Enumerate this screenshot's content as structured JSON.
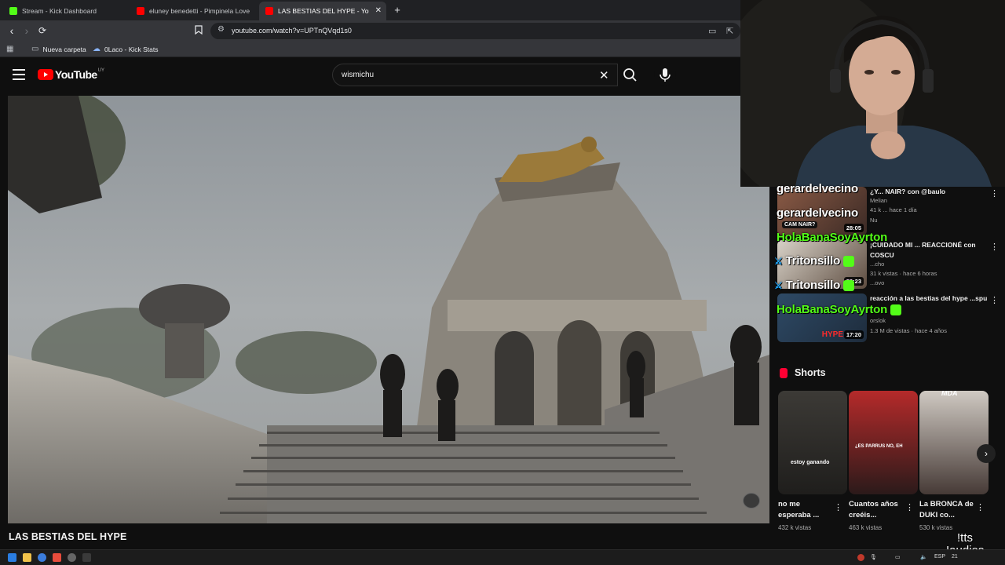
{
  "browser": {
    "tabs": [
      {
        "title": "Stream - Kick Dashboard",
        "favicon": "kick-icon",
        "color": "#53fc18"
      },
      {
        "title": "eluney benedetti - Pimpinela Love (p",
        "favicon": "youtube-icon",
        "color": "#ff0000"
      },
      {
        "title": "LAS BESTIAS DEL HYPE - YouTub",
        "favicon": "youtube-icon",
        "color": "#ff0000"
      }
    ],
    "url": "youtube.com/watch?v=UPTnQVqd1s0",
    "bookmarks": [
      {
        "label": "Nueva carpeta",
        "icon": "folder-icon"
      },
      {
        "label": "0Laco - Kick Stats",
        "icon": "kick-stats-icon"
      }
    ]
  },
  "youtube": {
    "logo_text": "YouTube",
    "country_code": "UY",
    "search_value": "wismichu",
    "video_title": "LAS BESTIAS DEL HYPE"
  },
  "recommendations": [
    {
      "title": "¿Y... NAIR? con @baulo",
      "channel": "Melian",
      "meta": "41 k ... hace 1 día",
      "duration": "28:05",
      "thumb_caption": "CAM NAIR?",
      "line2": "Nu"
    },
    {
      "title": "¡CUIDADO MI ... REACCIONÉ con COSCU",
      "channel": "...cho",
      "meta": "31 k vistas · hace 6 horas",
      "duration": "59:23",
      "line2": "...ovo"
    },
    {
      "title": "reacción a las bestias del hype ...spu",
      "channel": "orslok",
      "meta": "1.3 M de vistas · hace 4 años",
      "duration": "17:20",
      "thumb_caption": "HYPE"
    }
  ],
  "chat_overlay": [
    {
      "user": "gerardelvecino",
      "color": "white"
    },
    {
      "user": "gerardelvecino",
      "color": "white"
    },
    {
      "user": "HolaBanaSoyAyrton",
      "color": "green"
    },
    {
      "user": "Tritonsillo",
      "color": "white"
    },
    {
      "user": "Tritonsillo",
      "color": "white"
    },
    {
      "user": "HolaBanaSoyAyrton",
      "color": "green"
    }
  ],
  "shorts": {
    "heading": "Shorts",
    "items": [
      {
        "title": "no me esperaba ...",
        "views": "432 k vistas",
        "caption": "estoy ganando"
      },
      {
        "title": "Cuantos años creéis...",
        "views": "463 k vistas",
        "caption": "¿ES PARRUS NO, EH"
      },
      {
        "title": "La BRONCA de DUKI co...",
        "views": "530 k vistas",
        "caption": "MDA"
      }
    ]
  },
  "overlay": {
    "tts_line1": "!tts",
    "tts_line2": "!audios"
  },
  "taskbar": {
    "lang": "ESP",
    "time": "21"
  }
}
